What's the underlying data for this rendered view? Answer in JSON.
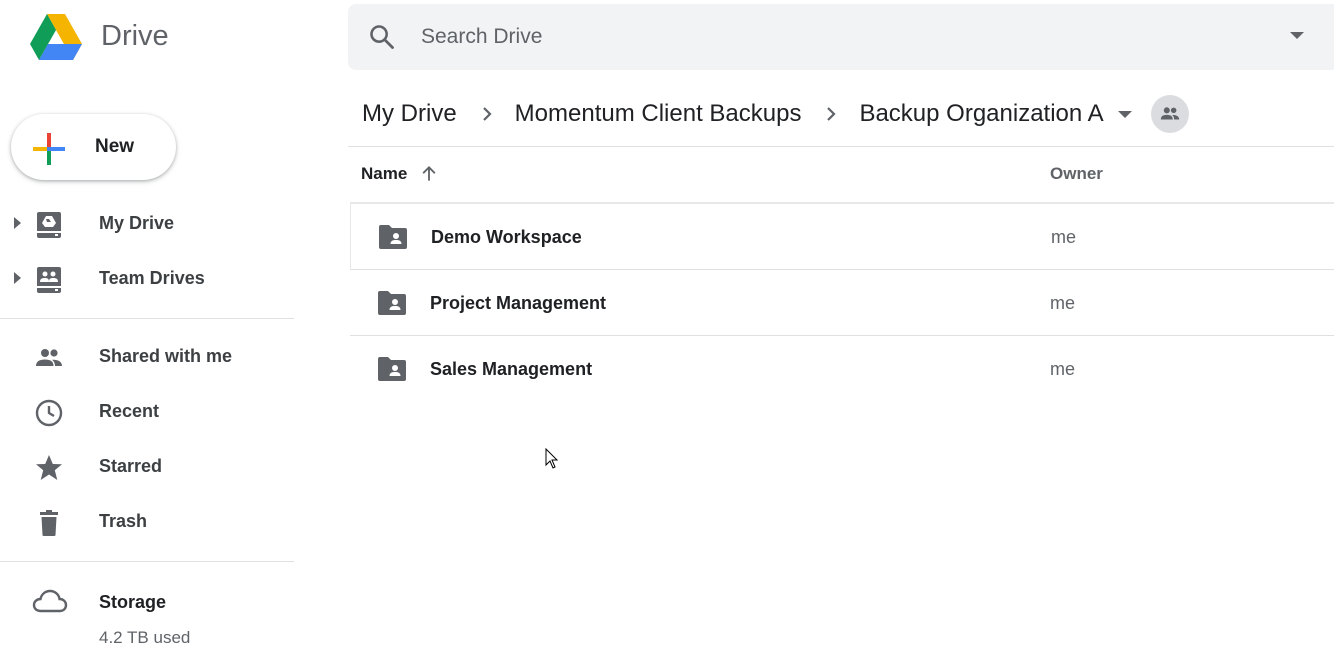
{
  "app": {
    "title": "Drive"
  },
  "search": {
    "placeholder": "Search Drive",
    "value": ""
  },
  "breadcrumb": [
    {
      "label": "My Drive"
    },
    {
      "label": "Momentum Client Backups"
    },
    {
      "label": "Backup Organization A"
    }
  ],
  "sidebar": {
    "new_label": "New",
    "items": [
      {
        "label": "My Drive",
        "icon": "my-drive-icon"
      },
      {
        "label": "Team Drives",
        "icon": "team-drives-icon"
      },
      {
        "label": "Shared with me",
        "icon": "people-icon"
      },
      {
        "label": "Recent",
        "icon": "clock-icon"
      },
      {
        "label": "Starred",
        "icon": "star-icon"
      },
      {
        "label": "Trash",
        "icon": "trash-icon"
      }
    ],
    "storage": {
      "label": "Storage",
      "used": "4.2 TB used",
      "icon": "cloud-icon"
    }
  },
  "table": {
    "columns": {
      "name": "Name",
      "owner": "Owner"
    },
    "rows": [
      {
        "name": "Demo Workspace",
        "owner": "me",
        "icon": "shared-folder-icon"
      },
      {
        "name": "Project Management",
        "owner": "me",
        "icon": "shared-folder-icon"
      },
      {
        "name": "Sales Management",
        "owner": "me",
        "icon": "shared-folder-icon"
      }
    ]
  },
  "colors": {
    "icon_gray": "#5f6368",
    "search_bg": "#f1f3f4",
    "drive_green": "#0f9d58",
    "drive_yellow": "#f4b400",
    "drive_blue": "#4285f4",
    "new_red": "#ea4335"
  }
}
